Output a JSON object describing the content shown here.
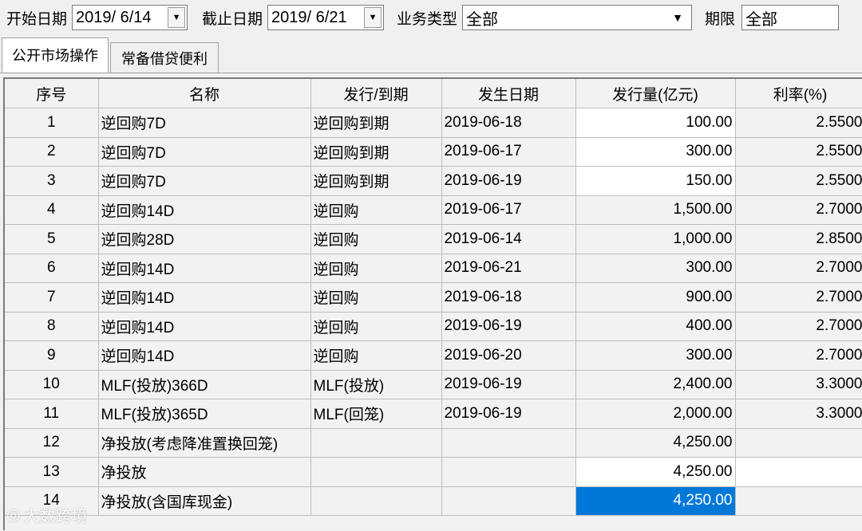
{
  "filters": {
    "start_label": "开始日期",
    "start_value": "2019/  6/14",
    "end_label": "截止日期",
    "end_value": "2019/  6/21",
    "type_label": "业务类型",
    "type_value": "全部",
    "term_label": "期限",
    "term_value": "全部"
  },
  "tabs": [
    {
      "label": "公开市场操作",
      "active": true
    },
    {
      "label": "常备借贷便利",
      "active": false
    }
  ],
  "table": {
    "columns": [
      "序号",
      "名称",
      "发行/到期",
      "发生日期",
      "发行量(亿元)",
      "利率(%)"
    ],
    "rows": [
      [
        "1",
        "逆回购7D",
        "逆回购到期",
        "2019-06-18",
        "100.00",
        "2.5500"
      ],
      [
        "2",
        "逆回购7D",
        "逆回购到期",
        "2019-06-17",
        "300.00",
        "2.5500"
      ],
      [
        "3",
        "逆回购7D",
        "逆回购到期",
        "2019-06-19",
        "150.00",
        "2.5500"
      ],
      [
        "4",
        "逆回购14D",
        "逆回购",
        "2019-06-17",
        "1,500.00",
        "2.7000"
      ],
      [
        "5",
        "逆回购28D",
        "逆回购",
        "2019-06-14",
        "1,000.00",
        "2.8500"
      ],
      [
        "6",
        "逆回购14D",
        "逆回购",
        "2019-06-21",
        "300.00",
        "2.7000"
      ],
      [
        "7",
        "逆回购14D",
        "逆回购",
        "2019-06-18",
        "900.00",
        "2.7000"
      ],
      [
        "8",
        "逆回购14D",
        "逆回购",
        "2019-06-19",
        "400.00",
        "2.7000"
      ],
      [
        "9",
        "逆回购14D",
        "逆回购",
        "2019-06-20",
        "300.00",
        "2.7000"
      ],
      [
        "10",
        "MLF(投放)366D",
        "MLF(投放)",
        "2019-06-19",
        "2,400.00",
        "3.3000"
      ],
      [
        "11",
        "MLF(投放)365D",
        "MLF(回笼)",
        "2019-06-19",
        "2,000.00",
        "3.3000"
      ],
      [
        "12",
        "净投放(考虑降准置换回笼)",
        "",
        "",
        "4,250.00",
        ""
      ],
      [
        "13",
        "净投放",
        "",
        "",
        "4,250.00",
        ""
      ],
      [
        "14",
        "净投放(含国库现金)",
        "",
        "",
        "4,250.00",
        ""
      ]
    ]
  },
  "watermark": "大数跨境",
  "colors": {
    "selection": "#0078d7",
    "background": "#f0f0f0"
  }
}
